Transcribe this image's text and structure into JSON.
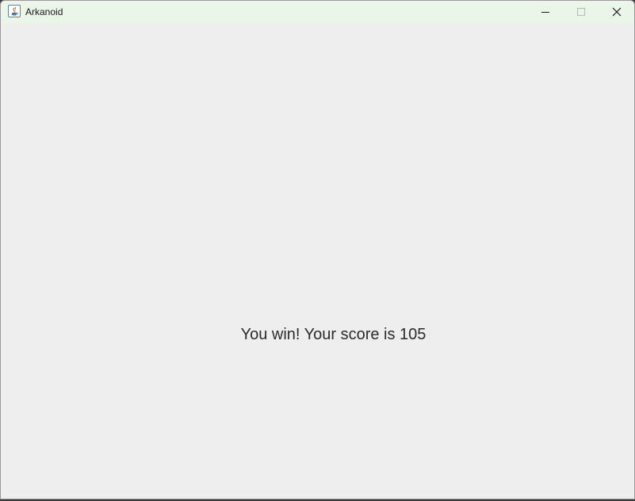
{
  "window": {
    "title": "Arkanoid",
    "controls": {
      "minimize_icon": "minimize-icon",
      "maximize_icon": "maximize-icon",
      "close_icon": "close-icon"
    }
  },
  "game": {
    "message": "You win! Your score is 105"
  },
  "colors": {
    "titlebar": "#eaf6e8",
    "background": "#eeeeee",
    "text": "#2b2b2b"
  }
}
